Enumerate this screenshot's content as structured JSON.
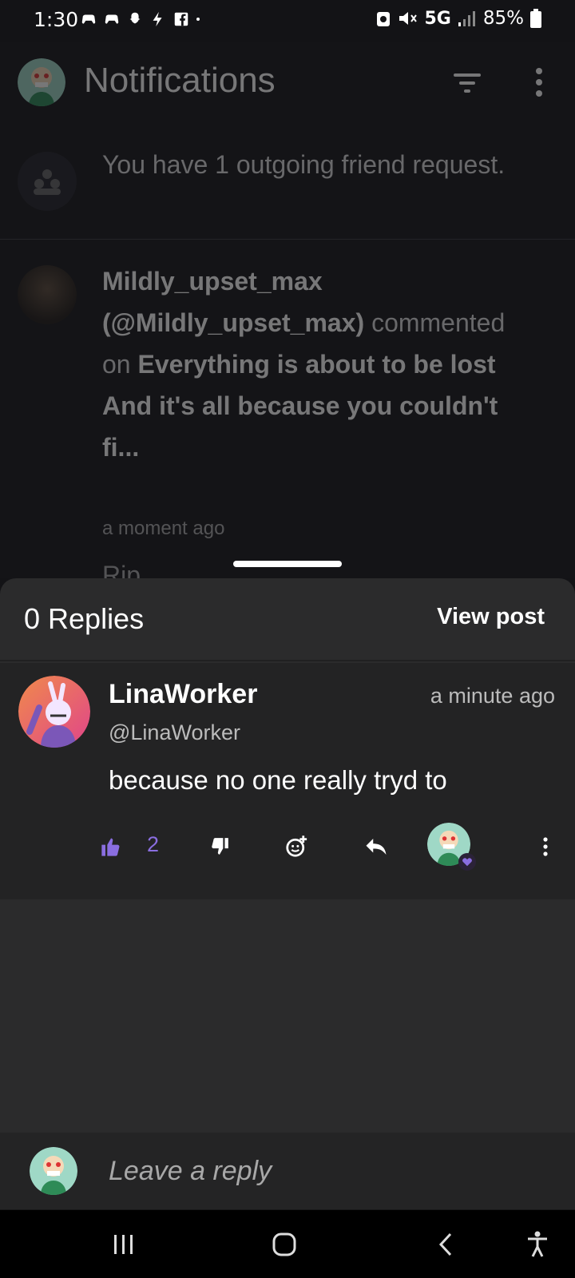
{
  "status_bar": {
    "time": "1:30",
    "network": "5G",
    "battery": "85%"
  },
  "notifications": {
    "title": "Notifications",
    "friend_request_text": "You have 1 outgoing friend request.",
    "comment_user": "Mildly_upset_max (@Mildly_upset_max)",
    "comment_action": "commented on",
    "comment_target": "Everything is about to be lost And it's all because you couldn't fi...",
    "comment_time": "a moment ago",
    "comment_snippet": "Rip"
  },
  "sheet": {
    "replies_label": "0 Replies",
    "view_post_label": "View post"
  },
  "comment": {
    "author_name": "LinaWorker",
    "author_handle": "@LinaWorker",
    "time": "a minute ago",
    "body": "because no one really tryd to",
    "like_count": "2"
  },
  "reply": {
    "placeholder": "Leave a reply"
  },
  "colors": {
    "accent": "#8a6ee0",
    "sheet_bg": "#2b2b2c",
    "comment_bg": "#232324"
  }
}
